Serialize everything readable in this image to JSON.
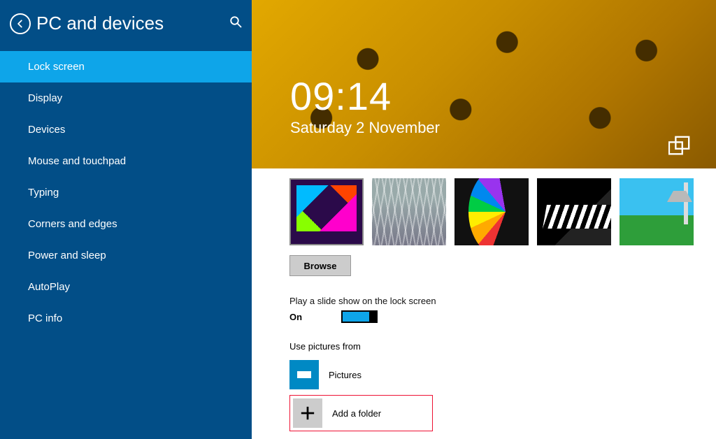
{
  "header": {
    "title": "PC and devices"
  },
  "sidebar": {
    "items": [
      {
        "label": "Lock screen",
        "active": true
      },
      {
        "label": "Display"
      },
      {
        "label": "Devices"
      },
      {
        "label": "Mouse and touchpad"
      },
      {
        "label": "Typing"
      },
      {
        "label": "Corners and edges"
      },
      {
        "label": "Power and sleep"
      },
      {
        "label": "AutoPlay"
      },
      {
        "label": "PC info"
      }
    ]
  },
  "lockscreen": {
    "time": "09:14",
    "date": "Saturday 2 November"
  },
  "buttons": {
    "browse": "Browse",
    "add_folder": "Add a folder"
  },
  "slideshow": {
    "label": "Play a slide show on the lock screen",
    "state_text": "On",
    "on": true
  },
  "pictures_from": {
    "label": "Use pictures from",
    "folders": [
      {
        "name": "Pictures"
      }
    ]
  }
}
